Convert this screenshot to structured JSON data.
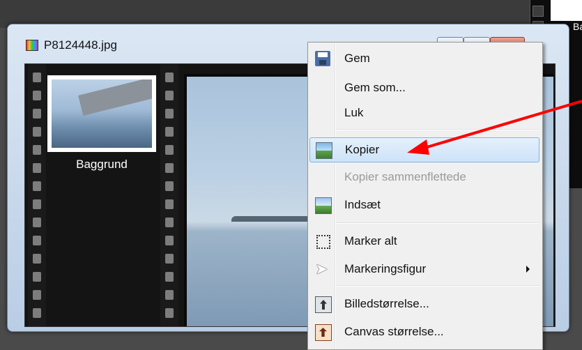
{
  "window": {
    "title": "P8124448.jpg"
  },
  "layer_panel": {
    "layer_name": "Baggrund"
  },
  "background": {
    "right_label": "Ba"
  },
  "context_menu": {
    "items": [
      {
        "label": "Gem",
        "icon": "save-icon",
        "enabled": true
      },
      {
        "label": "Gem som...",
        "icon": "",
        "enabled": true
      },
      {
        "label": "Luk",
        "icon": "",
        "enabled": true
      },
      {
        "label": "Kopier",
        "icon": "copy-image-icon",
        "enabled": true,
        "highlighted": true
      },
      {
        "label": "Kopier sammenflettede",
        "icon": "",
        "enabled": false
      },
      {
        "label": "Indsæt",
        "icon": "paste-image-icon",
        "enabled": true
      },
      {
        "label": "Marker alt",
        "icon": "select-all-icon",
        "enabled": true
      },
      {
        "label": "Markeringsfigur",
        "icon": "cursor-icon",
        "enabled": true,
        "submenu": true
      },
      {
        "label": "Billedstørrelse...",
        "icon": "image-size-icon",
        "enabled": true
      },
      {
        "label": "Canvas størrelse...",
        "icon": "canvas-size-icon",
        "enabled": true
      }
    ]
  },
  "colors": {
    "menu_highlight": "#cde3f8",
    "annotation_arrow": "#ff0000",
    "close_button": "#c7432b"
  }
}
